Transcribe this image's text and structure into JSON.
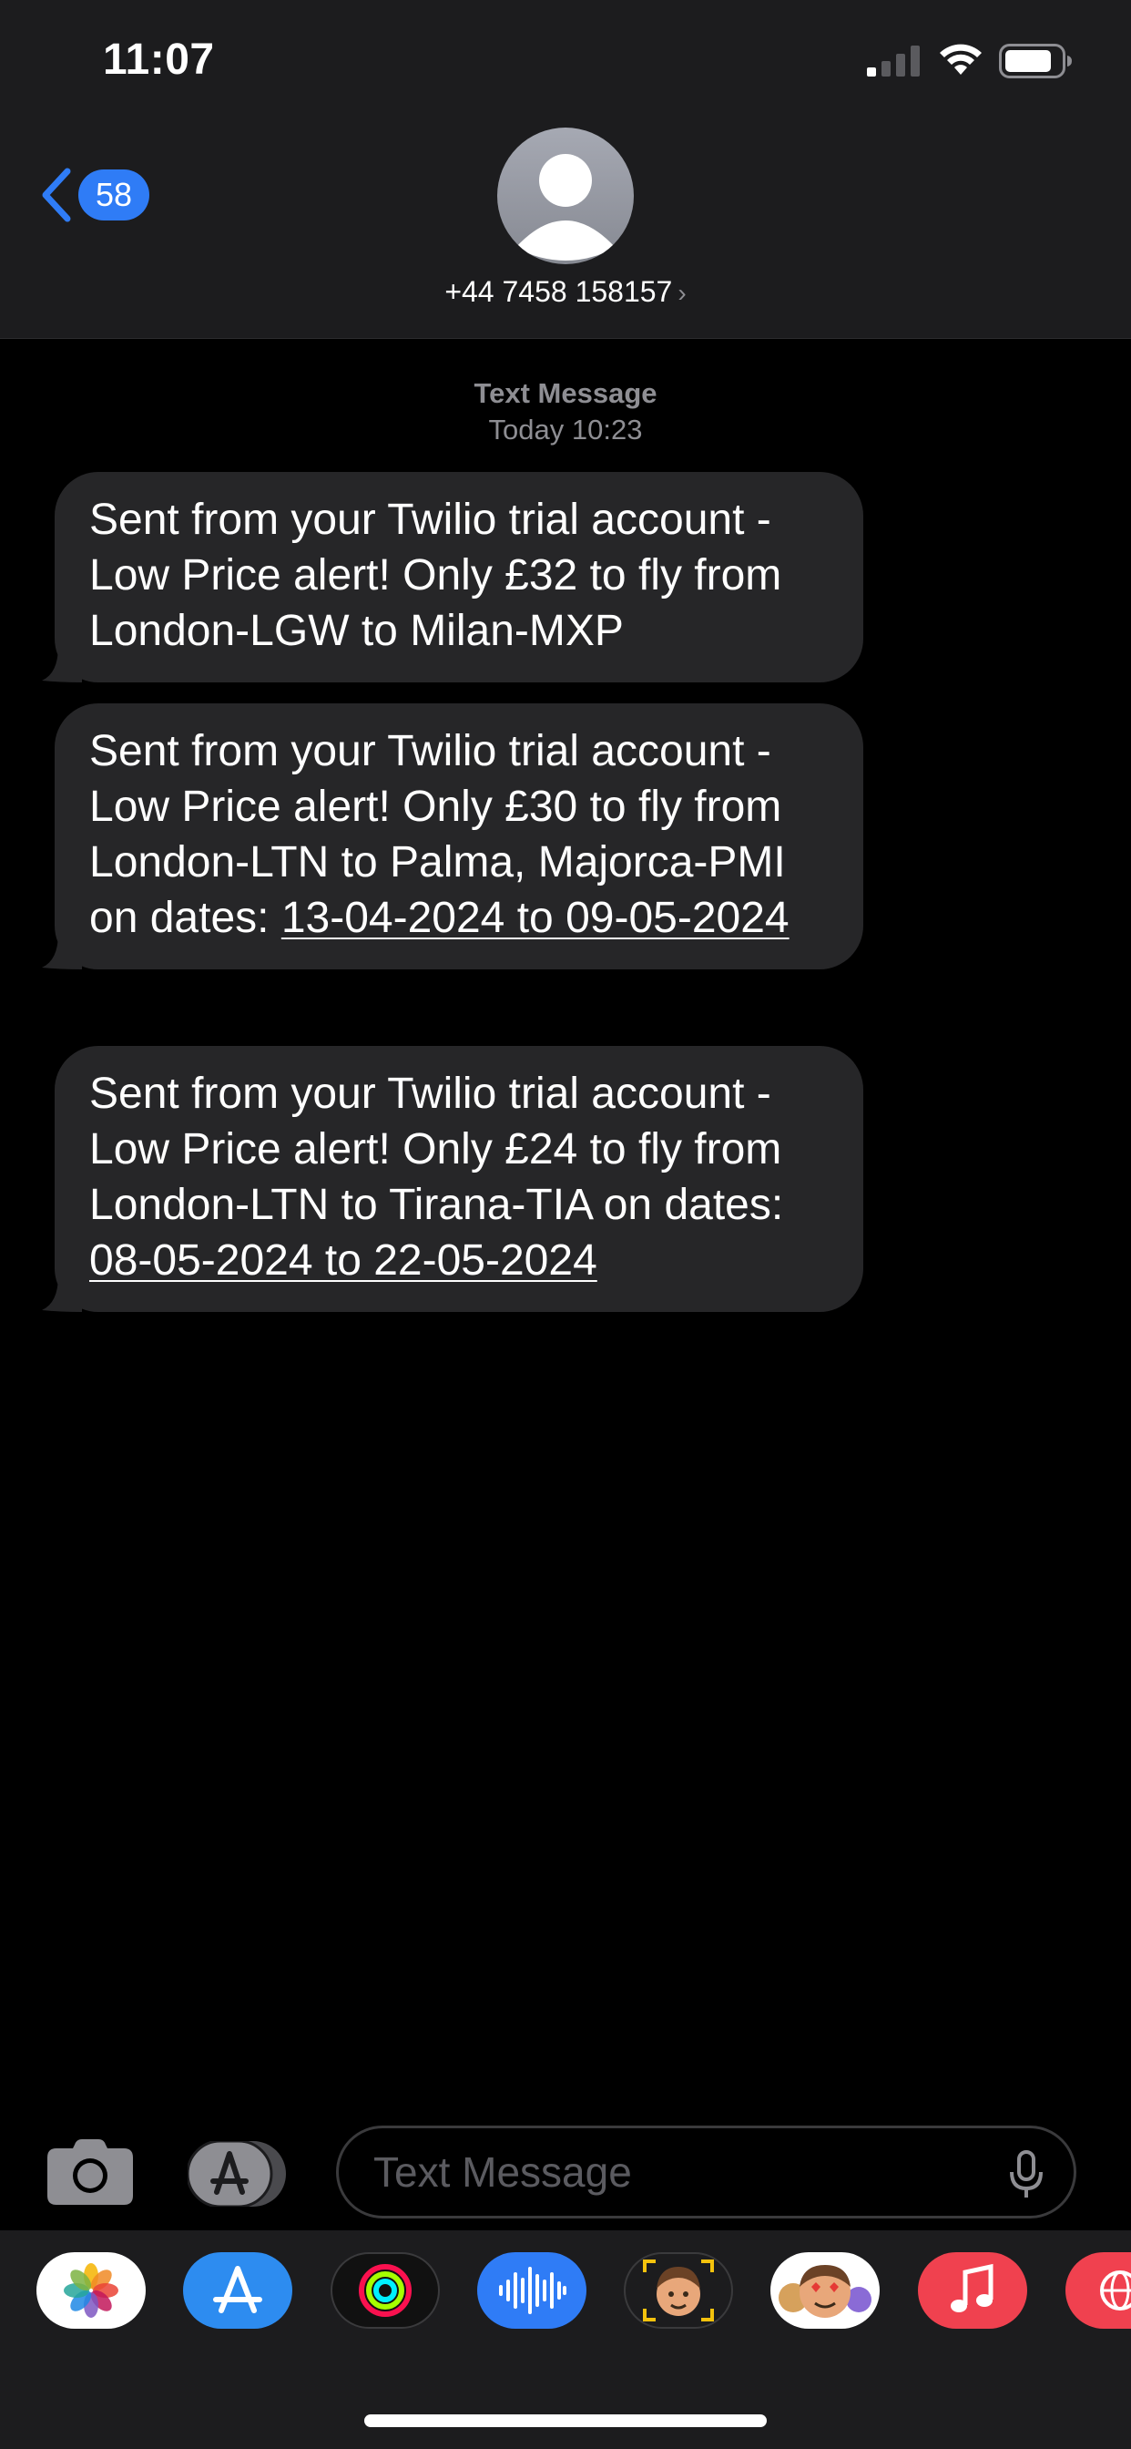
{
  "status_bar": {
    "time": "11:07"
  },
  "header": {
    "back_badge_count": "58",
    "contact_name": "+44 7458 158157",
    "contact_chevron": "›"
  },
  "conversation": {
    "timestamp_label": "Text Message",
    "timestamp_time": "Today 10:23",
    "messages": [
      {
        "text": "Sent from your Twilio trial account - Low Price alert! Only £32 to fly from London-LGW to Milan-MXP",
        "links": []
      },
      {
        "text_before": "Sent from your Twilio trial account - Low Price alert! Only £30 to fly from London-LTN to Palma, Majorca-PMI on dates: ",
        "link": "13-04-2024 to 09-05-2024"
      },
      {
        "text_before": "Sent from your Twilio trial account - Low Price alert! Only £24 to fly from London-LTN to Tirana-TIA on dates: ",
        "link": "08-05-2024 to 22-05-2024"
      }
    ]
  },
  "input_bar": {
    "placeholder": "Text Message"
  },
  "app_drawer": {
    "apps": [
      "photos-app-icon",
      "app-store-app-icon",
      "activity-app-icon",
      "audio-message-app-icon",
      "memoji-app-icon",
      "memoji-stickers-app-icon",
      "music-app-icon",
      "web-search-app-icon"
    ]
  },
  "colors": {
    "accent": "#2f7cf6",
    "bubble_received": "#262628",
    "header_bg": "#1c1c1e",
    "music_red": "#f0414f"
  }
}
